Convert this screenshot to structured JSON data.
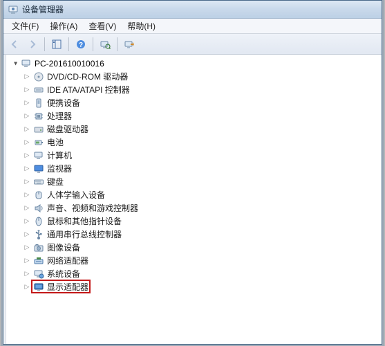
{
  "window": {
    "title": "设备管理器"
  },
  "menu": {
    "file": "文件(F)",
    "action": "操作(A)",
    "view": "查看(V)",
    "help": "帮助(H)"
  },
  "tree": {
    "root_label": "PC-201610010016",
    "items": [
      {
        "label": "DVD/CD-ROM 驱动器",
        "icon": "disc"
      },
      {
        "label": "IDE ATA/ATAPI 控制器",
        "icon": "ide"
      },
      {
        "label": "便携设备",
        "icon": "portable"
      },
      {
        "label": "处理器",
        "icon": "cpu"
      },
      {
        "label": "磁盘驱动器",
        "icon": "disk"
      },
      {
        "label": "电池",
        "icon": "battery"
      },
      {
        "label": "计算机",
        "icon": "computer"
      },
      {
        "label": "监视器",
        "icon": "monitor"
      },
      {
        "label": "键盘",
        "icon": "keyboard"
      },
      {
        "label": "人体学输入设备",
        "icon": "hid"
      },
      {
        "label": "声音、视频和游戏控制器",
        "icon": "sound"
      },
      {
        "label": "鼠标和其他指针设备",
        "icon": "mouse"
      },
      {
        "label": "通用串行总线控制器",
        "icon": "usb"
      },
      {
        "label": "图像设备",
        "icon": "imaging"
      },
      {
        "label": "网络适配器",
        "icon": "network"
      },
      {
        "label": "系统设备",
        "icon": "system"
      },
      {
        "label": "显示适配器",
        "icon": "display"
      }
    ]
  },
  "highlight_index": 16
}
